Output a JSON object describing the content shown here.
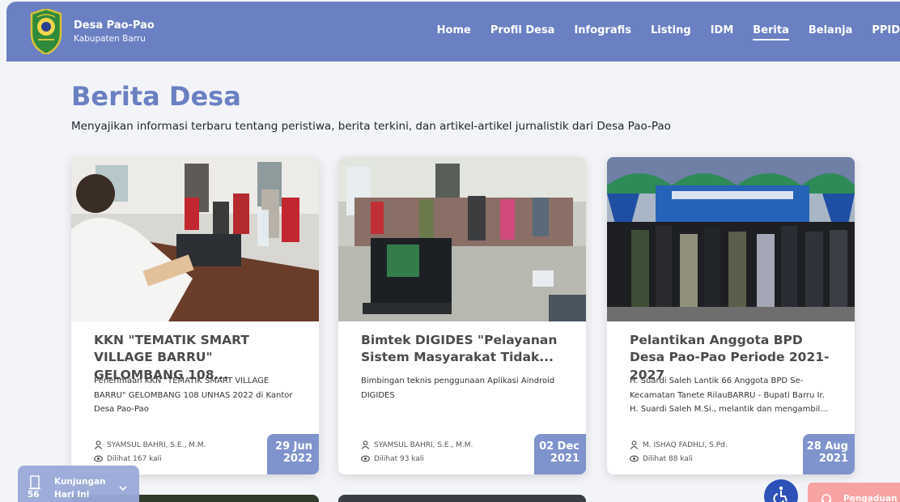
{
  "brand": {
    "name": "Desa Pao-Pao",
    "subtitle": "Kabupaten Barru"
  },
  "nav": [
    {
      "label": "Home"
    },
    {
      "label": "Profil Desa"
    },
    {
      "label": "Infografis"
    },
    {
      "label": "Listing"
    },
    {
      "label": "IDM"
    },
    {
      "label": "Berita",
      "active": true
    },
    {
      "label": "Belanja"
    },
    {
      "label": "PPID"
    }
  ],
  "page": {
    "title": "Berita Desa",
    "subtitle": "Menyajikan informasi terbaru tentang peristiwa, berita terkini, dan artikel-artikel jurnalistik dari Desa Pao-Pao"
  },
  "articles": [
    {
      "title": "KKN \"TEMATIK SMART VILLAGE BARRU\" GELOMBANG 108...",
      "desc": "Penerimaan KKN \"TEMATIK SMART VILLAGE BARRU\" GELOMBANG 108 UNHAS 2022 di Kantor Desa Pao-Pao",
      "author": "SYAMSUL BAHRI, S.E., M.M.",
      "views": "Dilihat 167 kali",
      "date_day": "29 Jun",
      "date_year": "2022"
    },
    {
      "title": "Bimtek DIGIDES \"Pelayanan Sistem Masyarakat Tidak...",
      "desc": "Bimbingan teknis penggunaan Aplikasi Aindroid DIGIDES",
      "author": "SYAMSUL BAHRI, S.E., M.M.",
      "views": "Dilihat 93 kali",
      "date_day": "02 Dec",
      "date_year": "2021"
    },
    {
      "title": "Pelantikan Anggota BPD Desa Pao-Pao Periode 2021-2027",
      "desc": "H. Suardi Saleh Lantik 66 Anggota BPD Se-Kecamatan Tanete RilauBARRU - Bupati Barru Ir. H. Suardi Saleh M.Si., melantik dan mengambil...",
      "author": "M. ISHAQ FADHLI, S.Pd.",
      "views": "Dilihat 88 kali",
      "date_day": "28 Aug",
      "date_year": "2021"
    }
  ],
  "visits": {
    "label_line1": "Kunjungan",
    "label_line2": "Hari Ini",
    "count": "56"
  },
  "complaint": {
    "label": "Pengaduan"
  },
  "colors": {
    "primary": "#6a80c2",
    "date_badge": "#7f93cc",
    "complaint": "#f7a3a3",
    "accessibility": "#2d51b8"
  }
}
